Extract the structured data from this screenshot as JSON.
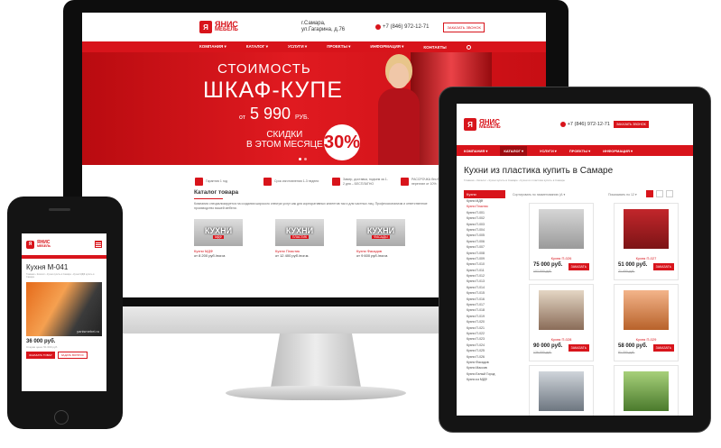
{
  "brand": {
    "line1": "ЯНИС",
    "line2": "МЕБЕЛЬ"
  },
  "desktop": {
    "address": "г.Самара, ул.Гагарина, д.76",
    "phone": "+7 (846) 972-12-71",
    "callback": "ЗАКАЗАТЬ ЗВОНОК",
    "nav": [
      "КОМПАНИЯ ▾",
      "КАТАЛОГ ▾",
      "УСЛУГИ ▾",
      "ПРОЕКТЫ ▾",
      "ИНФОРМАЦИЯ ▾",
      "КОНТАКТЫ"
    ],
    "banner": {
      "line1": "СТОИМОСТЬ",
      "line2": "ШКАФ-КУПЕ",
      "price_prefix": "от",
      "price": "5 990",
      "currency": "РУБ.",
      "discount_line1": "СКИДКИ",
      "discount_line2": "В ЭТОМ МЕСЯЦЕ",
      "discount": "30%"
    },
    "features": [
      "Гарантия 1 год",
      "Срок изготовления 1-3 недели",
      "Замер, доставка, подъем за 1-2 дня – БЕСПЛАТНО",
      "РАССРОЧКА без банка и переплат от 10%"
    ],
    "catalog": {
      "title": "Каталог товара",
      "text": "Компания специализируется на создании широкого спектра услуг как для корпоративных клиентов так и для частных лиц. Профессионализм и ответственное производство вашей мебели.",
      "tiles": [
        {
          "big": "КУХНИ",
          "tag": "МДФ",
          "name": "Кухни МДФ",
          "price": "от 8 200 руб./пог.м."
        },
        {
          "big": "КУХНИ",
          "tag": "ПЛАСТИК",
          "name": "Кухни Пластик",
          "price": "от 12 400 руб./пог.м."
        },
        {
          "big": "КУХНИ",
          "tag": "ФАСАДЫ",
          "name": "Кухни Фасадов",
          "price": "от 9 600 руб./пог.м."
        }
      ]
    }
  },
  "tablet": {
    "phone": "+7 (846) 972-12-71",
    "callback": "ЗАКАЗАТЬ ЗВОНОК",
    "nav": [
      "КОМПАНИЯ ▾",
      "КАТАЛОГ ▾",
      "УСЛУГИ ▾",
      "ПРОЕКТЫ ▾",
      "ИНФОРМАЦИЯ ▾"
    ],
    "title": "Кухни из пластика купить в Самаре",
    "breadcrumbs": "Главная  ›  Каталог  ›  Кухни купить в Самаре  ›  Кухни из пластика купить в Самаре",
    "sidebar_title": "Кухни",
    "sidebar_items": [
      "Кухни МДФ",
      "Кухни Пластик",
      "Кухни П-001",
      "Кухни П-002",
      "Кухни П-003",
      "Кухни П-004",
      "Кухни П-005",
      "Кухни П-006",
      "Кухни П-007",
      "Кухни П-008",
      "Кухни П-009",
      "Кухни П-010",
      "Кухни П-011",
      "Кухни П-012",
      "Кухни П-013",
      "Кухни П-014",
      "Кухни П-015",
      "Кухни П-016",
      "Кухни П-017",
      "Кухни П-018",
      "Кухни П-019",
      "Кухни П-020",
      "Кухни П-021",
      "Кухни П-022",
      "Кухни П-023",
      "Кухни П-024",
      "Кухни П-025",
      "Кухни П-026",
      "Кухни Фасадов",
      "Кухни Массив",
      "Кухни Белый Город",
      "Кухни из МДФ"
    ],
    "sort_label": "Сортировать по наименованию (А ▾",
    "show_label": "Показывать по 12 ▾",
    "products": [
      {
        "name": "Кухня П-026",
        "price": "75 000 руб.",
        "old": "107 000 руб.",
        "btn": "ЗАКАЗАТЬ"
      },
      {
        "name": "Кухня П-027",
        "price": "51 000 руб.",
        "old": "71 400 руб.",
        "btn": "ЗАКАЗАТЬ"
      },
      {
        "name": "Кухня П-028",
        "price": "90 000 руб.",
        "old": "126 000 руб.",
        "btn": "ЗАКАЗАТЬ"
      },
      {
        "name": "Кухня П-029",
        "price": "58 000 руб.",
        "old": "81 200 руб.",
        "btn": "ЗАКАЗАТЬ"
      }
    ]
  },
  "phone": {
    "title": "Кухня М-041",
    "breadcrumbs": "Главная  ›  Каталог  ›  Кухни купить в Самаре  ›  Кухни МДФ купить в Самаре",
    "watermark": "yanismebel.ru",
    "price": "36 000 руб.",
    "old_price": "Старая цена: 51 000 руб.",
    "order_btn": "ЗАКАЗАТЬ ТОВАР",
    "question_btn": "ЗАДАТЬ ВОПРОС"
  },
  "colors": {
    "brand_red": "#d8141b",
    "dark_red": "#9e0c10"
  }
}
